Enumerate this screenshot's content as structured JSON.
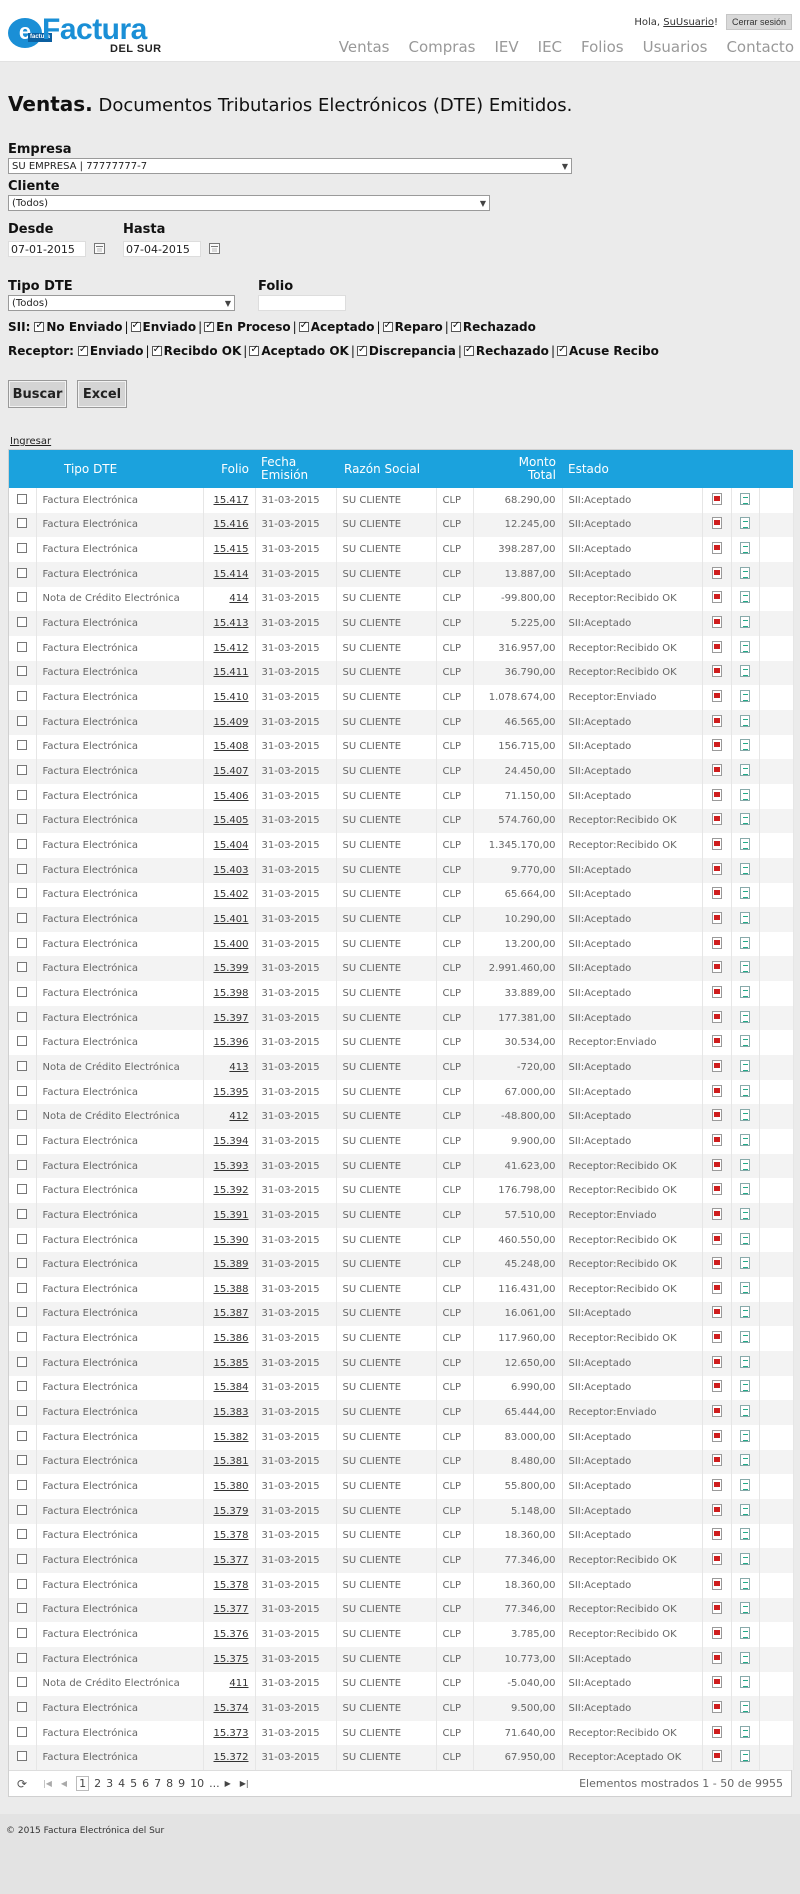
{
  "logo": {
    "badge": "e",
    "badge_sub": "factura",
    "brand": "Factura",
    "brand_sub": "DEL SUR"
  },
  "user": {
    "greeting": "Hola,",
    "username": "SuUsuario",
    "suffix": "!",
    "logout": "Cerrar sesión"
  },
  "nav": [
    "Ventas",
    "Compras",
    "IEV",
    "IEC",
    "Folios",
    "Usuarios",
    "Contacto"
  ],
  "page": {
    "title_bold": "Ventas.",
    "title_rest": " Documentos Tributarios Electrónicos (DTE) Emitidos."
  },
  "form": {
    "empresa_label": "Empresa",
    "empresa_value": "SU EMPRESA | 77777777-7",
    "cliente_label": "Cliente",
    "cliente_value": "(Todos)",
    "desde_label": "Desde",
    "desde_value": "07-01-2015",
    "hasta_label": "Hasta",
    "hasta_value": "07-04-2015",
    "tipo_label": "Tipo DTE",
    "tipo_value": "(Todos)",
    "folio_label": "Folio",
    "folio_value": ""
  },
  "sii_filter": {
    "label": "SII:",
    "options": [
      "No Enviado",
      "Enviado",
      "En Proceso",
      "Aceptado",
      "Reparo",
      "Rechazado"
    ]
  },
  "receptor_filter": {
    "label": "Receptor:",
    "options": [
      "Enviado",
      "Recibdo OK",
      "Aceptado OK",
      "Discrepancia",
      "Rechazado",
      "Acuse Recibo"
    ]
  },
  "buttons": {
    "buscar": "Buscar",
    "excel": "Excel"
  },
  "ingresar": "Ingresar",
  "table": {
    "headers": {
      "tipo": "Tipo DTE",
      "folio": "Folio",
      "fecha_1": "Fecha",
      "fecha_2": "Emisión",
      "razon": "Razón Social",
      "monto_1": "Monto",
      "monto_2": "Total",
      "estado": "Estado"
    },
    "rows": [
      [
        "Factura Electrónica",
        "15.417",
        "31-03-2015",
        "SU CLIENTE",
        "CLP",
        "68.290,00",
        "SII:Aceptado"
      ],
      [
        "Factura Electrónica",
        "15.416",
        "31-03-2015",
        "SU CLIENTE",
        "CLP",
        "12.245,00",
        "SII:Aceptado"
      ],
      [
        "Factura Electrónica",
        "15.415",
        "31-03-2015",
        "SU CLIENTE",
        "CLP",
        "398.287,00",
        "SII:Aceptado"
      ],
      [
        "Factura Electrónica",
        "15.414",
        "31-03-2015",
        "SU CLIENTE",
        "CLP",
        "13.887,00",
        "SII:Aceptado"
      ],
      [
        "Nota de Crédito Electrónica",
        "414",
        "31-03-2015",
        "SU CLIENTE",
        "CLP",
        "-99.800,00",
        "Receptor:Recibido OK"
      ],
      [
        "Factura Electrónica",
        "15.413",
        "31-03-2015",
        "SU CLIENTE",
        "CLP",
        "5.225,00",
        "SII:Aceptado"
      ],
      [
        "Factura Electrónica",
        "15.412",
        "31-03-2015",
        "SU CLIENTE",
        "CLP",
        "316.957,00",
        "Receptor:Recibido OK"
      ],
      [
        "Factura Electrónica",
        "15.411",
        "31-03-2015",
        "SU CLIENTE",
        "CLP",
        "36.790,00",
        "Receptor:Recibido OK"
      ],
      [
        "Factura Electrónica",
        "15.410",
        "31-03-2015",
        "SU CLIENTE",
        "CLP",
        "1.078.674,00",
        "Receptor:Enviado"
      ],
      [
        "Factura Electrónica",
        "15.409",
        "31-03-2015",
        "SU CLIENTE",
        "CLP",
        "46.565,00",
        "SII:Aceptado"
      ],
      [
        "Factura Electrónica",
        "15.408",
        "31-03-2015",
        "SU CLIENTE",
        "CLP",
        "156.715,00",
        "SII:Aceptado"
      ],
      [
        "Factura Electrónica",
        "15.407",
        "31-03-2015",
        "SU CLIENTE",
        "CLP",
        "24.450,00",
        "SII:Aceptado"
      ],
      [
        "Factura Electrónica",
        "15.406",
        "31-03-2015",
        "SU CLIENTE",
        "CLP",
        "71.150,00",
        "SII:Aceptado"
      ],
      [
        "Factura Electrónica",
        "15.405",
        "31-03-2015",
        "SU CLIENTE",
        "CLP",
        "574.760,00",
        "Receptor:Recibido OK"
      ],
      [
        "Factura Electrónica",
        "15.404",
        "31-03-2015",
        "SU CLIENTE",
        "CLP",
        "1.345.170,00",
        "Receptor:Recibido OK"
      ],
      [
        "Factura Electrónica",
        "15.403",
        "31-03-2015",
        "SU CLIENTE",
        "CLP",
        "9.770,00",
        "SII:Aceptado"
      ],
      [
        "Factura Electrónica",
        "15.402",
        "31-03-2015",
        "SU CLIENTE",
        "CLP",
        "65.664,00",
        "SII:Aceptado"
      ],
      [
        "Factura Electrónica",
        "15.401",
        "31-03-2015",
        "SU CLIENTE",
        "CLP",
        "10.290,00",
        "SII:Aceptado"
      ],
      [
        "Factura Electrónica",
        "15.400",
        "31-03-2015",
        "SU CLIENTE",
        "CLP",
        "13.200,00",
        "SII:Aceptado"
      ],
      [
        "Factura Electrónica",
        "15.399",
        "31-03-2015",
        "SU CLIENTE",
        "CLP",
        "2.991.460,00",
        "SII:Aceptado"
      ],
      [
        "Factura Electrónica",
        "15.398",
        "31-03-2015",
        "SU CLIENTE",
        "CLP",
        "33.889,00",
        "SII:Aceptado"
      ],
      [
        "Factura Electrónica",
        "15.397",
        "31-03-2015",
        "SU CLIENTE",
        "CLP",
        "177.381,00",
        "SII:Aceptado"
      ],
      [
        "Factura Electrónica",
        "15.396",
        "31-03-2015",
        "SU CLIENTE",
        "CLP",
        "30.534,00",
        "Receptor:Enviado"
      ],
      [
        "Nota de Crédito Electrónica",
        "413",
        "31-03-2015",
        "SU CLIENTE",
        "CLP",
        "-720,00",
        "SII:Aceptado"
      ],
      [
        "Factura Electrónica",
        "15.395",
        "31-03-2015",
        "SU CLIENTE",
        "CLP",
        "67.000,00",
        "SII:Aceptado"
      ],
      [
        "Nota de Crédito Electrónica",
        "412",
        "31-03-2015",
        "SU CLIENTE",
        "CLP",
        "-48.800,00",
        "SII:Aceptado"
      ],
      [
        "Factura Electrónica",
        "15.394",
        "31-03-2015",
        "SU CLIENTE",
        "CLP",
        "9.900,00",
        "SII:Aceptado"
      ],
      [
        "Factura Electrónica",
        "15.393",
        "31-03-2015",
        "SU CLIENTE",
        "CLP",
        "41.623,00",
        "Receptor:Recibido OK"
      ],
      [
        "Factura Electrónica",
        "15.392",
        "31-03-2015",
        "SU CLIENTE",
        "CLP",
        "176.798,00",
        "Receptor:Recibido OK"
      ],
      [
        "Factura Electrónica",
        "15.391",
        "31-03-2015",
        "SU CLIENTE",
        "CLP",
        "57.510,00",
        "Receptor:Enviado"
      ],
      [
        "Factura Electrónica",
        "15.390",
        "31-03-2015",
        "SU CLIENTE",
        "CLP",
        "460.550,00",
        "Receptor:Recibido OK"
      ],
      [
        "Factura Electrónica",
        "15.389",
        "31-03-2015",
        "SU CLIENTE",
        "CLP",
        "45.248,00",
        "Receptor:Recibido OK"
      ],
      [
        "Factura Electrónica",
        "15.388",
        "31-03-2015",
        "SU CLIENTE",
        "CLP",
        "116.431,00",
        "Receptor:Recibido OK"
      ],
      [
        "Factura Electrónica",
        "15.387",
        "31-03-2015",
        "SU CLIENTE",
        "CLP",
        "16.061,00",
        "SII:Aceptado"
      ],
      [
        "Factura Electrónica",
        "15.386",
        "31-03-2015",
        "SU CLIENTE",
        "CLP",
        "117.960,00",
        "Receptor:Recibido OK"
      ],
      [
        "Factura Electrónica",
        "15.385",
        "31-03-2015",
        "SU CLIENTE",
        "CLP",
        "12.650,00",
        "SII:Aceptado"
      ],
      [
        "Factura Electrónica",
        "15.384",
        "31-03-2015",
        "SU CLIENTE",
        "CLP",
        "6.990,00",
        "SII:Aceptado"
      ],
      [
        "Factura Electrónica",
        "15.383",
        "31-03-2015",
        "SU CLIENTE",
        "CLP",
        "65.444,00",
        "Receptor:Enviado"
      ],
      [
        "Factura Electrónica",
        "15.382",
        "31-03-2015",
        "SU CLIENTE",
        "CLP",
        "83.000,00",
        "SII:Aceptado"
      ],
      [
        "Factura Electrónica",
        "15.381",
        "31-03-2015",
        "SU CLIENTE",
        "CLP",
        "8.480,00",
        "SII:Aceptado"
      ],
      [
        "Factura Electrónica",
        "15.380",
        "31-03-2015",
        "SU CLIENTE",
        "CLP",
        "55.800,00",
        "SII:Aceptado"
      ],
      [
        "Factura Electrónica",
        "15.379",
        "31-03-2015",
        "SU CLIENTE",
        "CLP",
        "5.148,00",
        "SII:Aceptado"
      ],
      [
        "Factura Electrónica",
        "15.378",
        "31-03-2015",
        "SU CLIENTE",
        "CLP",
        "18.360,00",
        "SII:Aceptado"
      ],
      [
        "Factura Electrónica",
        "15.377",
        "31-03-2015",
        "SU CLIENTE",
        "CLP",
        "77.346,00",
        "Receptor:Recibido OK"
      ],
      [
        "Factura Electrónica",
        "15.378",
        "31-03-2015",
        "SU CLIENTE",
        "CLP",
        "18.360,00",
        "SII:Aceptado"
      ],
      [
        "Factura Electrónica",
        "15.377",
        "31-03-2015",
        "SU CLIENTE",
        "CLP",
        "77.346,00",
        "Receptor:Recibido OK"
      ],
      [
        "Factura Electrónica",
        "15.376",
        "31-03-2015",
        "SU CLIENTE",
        "CLP",
        "3.785,00",
        "Receptor:Recibido OK"
      ],
      [
        "Factura Electrónica",
        "15.375",
        "31-03-2015",
        "SU CLIENTE",
        "CLP",
        "10.773,00",
        "SII:Aceptado"
      ],
      [
        "Nota de Crédito Electrónica",
        "411",
        "31-03-2015",
        "SU CLIENTE",
        "CLP",
        "-5.040,00",
        "SII:Aceptado"
      ],
      [
        "Factura Electrónica",
        "15.374",
        "31-03-2015",
        "SU CLIENTE",
        "CLP",
        "9.500,00",
        "SII:Aceptado"
      ],
      [
        "Factura Electrónica",
        "15.373",
        "31-03-2015",
        "SU CLIENTE",
        "CLP",
        "71.640,00",
        "Receptor:Recibido OK"
      ],
      [
        "Factura Electrónica",
        "15.372",
        "31-03-2015",
        "SU CLIENTE",
        "CLP",
        "67.950,00",
        "Receptor:Aceptado OK"
      ]
    ]
  },
  "pager": {
    "pages": [
      "1",
      "2",
      "3",
      "4",
      "5",
      "6",
      "7",
      "8",
      "9",
      "10",
      "..."
    ],
    "current": "1",
    "info": "Elementos mostrados 1 - 50 de 9955"
  },
  "footer": "© 2015 Factura Electrónica del Sur",
  "colors": {
    "accent": "#1ba2dd",
    "brand": "#1a8fd6"
  }
}
